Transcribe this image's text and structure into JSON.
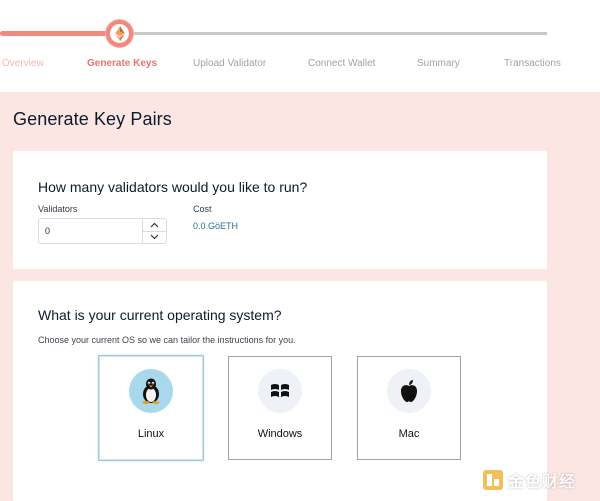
{
  "stepper": {
    "progress": 0.2,
    "steps": [
      {
        "label": "Overview",
        "state": "done"
      },
      {
        "label": "Generate Keys",
        "state": "active"
      },
      {
        "label": "Upload Validator",
        "state": "pending"
      },
      {
        "label": "Connect Wallet",
        "state": "pending"
      },
      {
        "label": "Summary",
        "state": "pending"
      },
      {
        "label": "Transactions",
        "state": "pending"
      }
    ],
    "active_icon": "ethereum-icon"
  },
  "page": {
    "title": "Generate Key Pairs"
  },
  "validators_card": {
    "heading": "How many validators would you like to run?",
    "validators_label": "Validators",
    "validators_value": "0",
    "cost_label": "Cost",
    "cost_value": "0.0 GöETH"
  },
  "os_card": {
    "heading": "What is your current operating system?",
    "subtext": "Choose your current OS so we can tailor the instructions for you.",
    "options": [
      {
        "label": "Linux",
        "icon": "linux-tux-icon",
        "selected": true
      },
      {
        "label": "Windows",
        "icon": "windows-icon",
        "selected": false
      },
      {
        "label": "Mac",
        "icon": "apple-icon",
        "selected": false
      }
    ]
  },
  "watermark": {
    "text": "金色财经"
  },
  "colors": {
    "accent": "#f4877b",
    "page_bg": "#fbe6e3",
    "cost_text": "#2c6e8f",
    "selected_os_circle": "#a9d8ec"
  }
}
